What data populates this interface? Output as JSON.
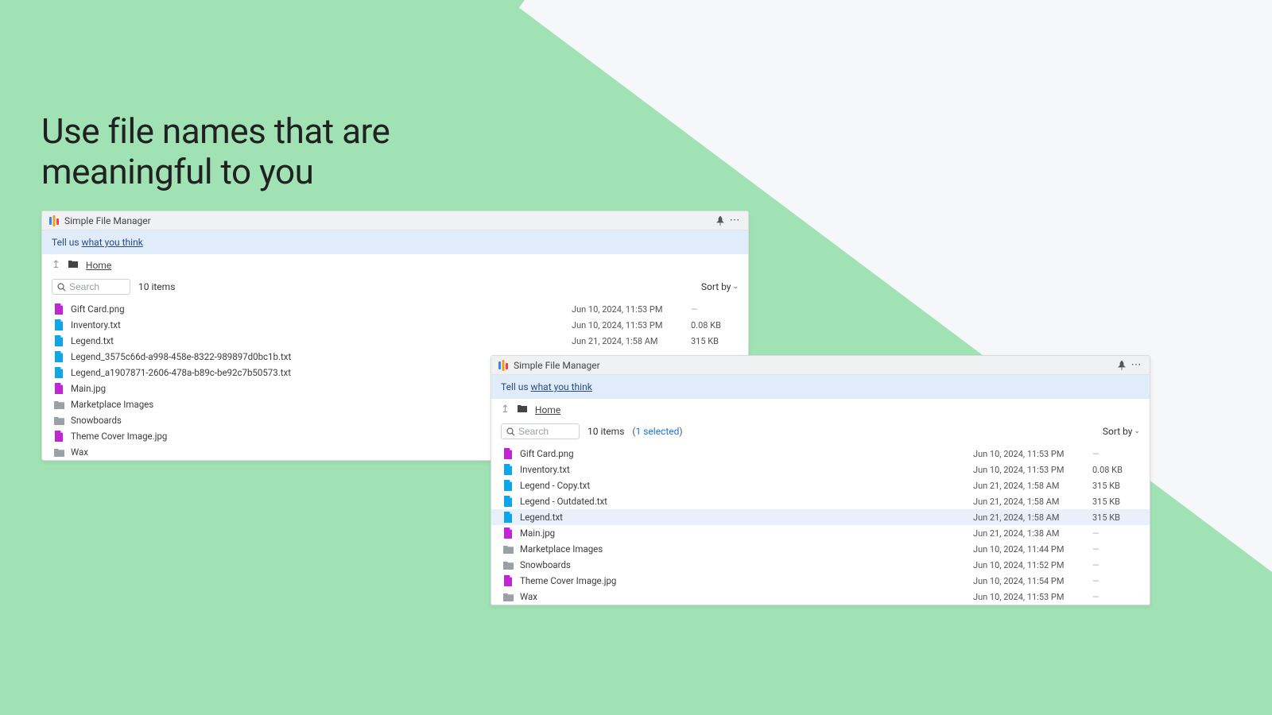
{
  "heading": {
    "line1": "Use file names that are",
    "line2": "meaningful to you"
  },
  "icon_colors": {
    "image": "#c026d3",
    "text": "#0ea5e9",
    "folder": "#9aa0a6"
  },
  "window1": {
    "title": "Simple File Manager",
    "banner_prefix": "Tell us ",
    "banner_link": "what you think",
    "breadcrumb": "Home",
    "search_placeholder": "Search",
    "item_count": "10 items",
    "sort_label": "Sort by",
    "files": [
      {
        "type": "image",
        "name": "Gift Card.png",
        "date": "Jun 10, 2024, 11:53 PM",
        "size": "—"
      },
      {
        "type": "text",
        "name": "Inventory.txt",
        "date": "Jun 10, 2024, 11:53 PM",
        "size": "0.08 KB"
      },
      {
        "type": "text",
        "name": "Legend.txt",
        "date": "Jun 21, 2024, 1:58 AM",
        "size": "315 KB"
      },
      {
        "type": "text",
        "name": "Legend_3575c66d-a998-458e-8322-989897d0bc1b.txt",
        "date": "",
        "size": ""
      },
      {
        "type": "text",
        "name": "Legend_a1907871-2606-478a-b89c-be92c7b50573.txt",
        "date": "",
        "size": ""
      },
      {
        "type": "image",
        "name": "Main.jpg",
        "date": "",
        "size": ""
      },
      {
        "type": "folder",
        "name": "Marketplace Images",
        "date": "",
        "size": ""
      },
      {
        "type": "folder",
        "name": "Snowboards",
        "date": "",
        "size": ""
      },
      {
        "type": "image",
        "name": "Theme Cover Image.jpg",
        "date": "",
        "size": ""
      },
      {
        "type": "folder",
        "name": "Wax",
        "date": "",
        "size": ""
      }
    ]
  },
  "window2": {
    "title": "Simple File Manager",
    "banner_prefix": "Tell us ",
    "banner_link": "what you think",
    "breadcrumb": "Home",
    "search_placeholder": "Search",
    "item_count": "10 items",
    "selected_text": "1 selected",
    "sort_label": "Sort by",
    "files": [
      {
        "type": "image",
        "name": "Gift Card.png",
        "date": "Jun 10, 2024, 11:53 PM",
        "size": "—"
      },
      {
        "type": "text",
        "name": "Inventory.txt",
        "date": "Jun 10, 2024, 11:53 PM",
        "size": "0.08 KB"
      },
      {
        "type": "text",
        "name": "Legend - Copy.txt",
        "date": "Jun 21, 2024, 1:58 AM",
        "size": "315 KB"
      },
      {
        "type": "text",
        "name": "Legend - Outdated.txt",
        "date": "Jun 21, 2024, 1:58 AM",
        "size": "315 KB"
      },
      {
        "type": "text",
        "name": "Legend.txt",
        "date": "Jun 21, 2024, 1:58 AM",
        "size": "315 KB",
        "selected": true
      },
      {
        "type": "image",
        "name": "Main.jpg",
        "date": "Jun 21, 2024, 1:38 AM",
        "size": "—"
      },
      {
        "type": "folder",
        "name": "Marketplace Images",
        "date": "Jun 10, 2024, 11:44 PM",
        "size": "—"
      },
      {
        "type": "folder",
        "name": "Snowboards",
        "date": "Jun 10, 2024, 11:52 PM",
        "size": "—"
      },
      {
        "type": "image",
        "name": "Theme Cover Image.jpg",
        "date": "Jun 10, 2024, 11:54 PM",
        "size": "—"
      },
      {
        "type": "folder",
        "name": "Wax",
        "date": "Jun 10, 2024, 11:53 PM",
        "size": "—"
      }
    ]
  }
}
